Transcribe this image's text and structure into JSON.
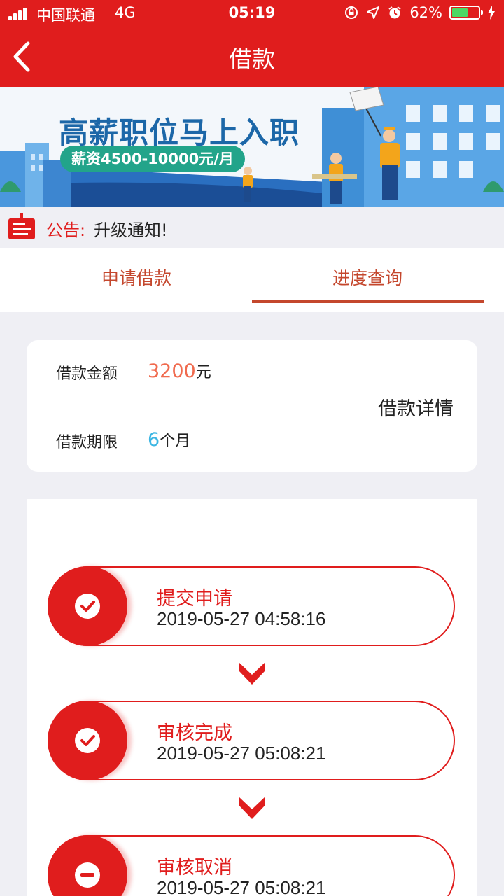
{
  "status_bar": {
    "carrier": "中国联通",
    "network": "4G",
    "time": "05:19",
    "battery_percent": "62%",
    "battery_level": 0.62,
    "icons": [
      "orientation-lock-icon",
      "location-icon",
      "alarm-icon",
      "charging-icon"
    ]
  },
  "nav": {
    "title": "借款",
    "back_icon": "chevron-left-icon"
  },
  "banner": {
    "headline": "高薪职位马上入职",
    "salary": "薪资4500-10000元/月"
  },
  "notice": {
    "tag": "公告:",
    "text": "升级通知!"
  },
  "tabs": [
    {
      "label": "申请借款",
      "active": false
    },
    {
      "label": "进度查询",
      "active": true
    }
  ],
  "loan": {
    "amount_label": "借款金额",
    "amount_value": "3200",
    "amount_unit": "元",
    "term_label": "借款期限",
    "term_value": "6",
    "term_unit": "个月",
    "detail_link": "借款详情"
  },
  "steps": [
    {
      "title": "提交申请",
      "time": "2019-05-27 04:58:16",
      "icon": "check-icon"
    },
    {
      "title": "审核完成",
      "time": "2019-05-27 05:08:21",
      "icon": "check-icon"
    },
    {
      "title": "审核取消",
      "time": "2019-05-27 05:08:21",
      "icon": "minus-icon"
    }
  ],
  "colors": {
    "brand_red": "#e01d1d",
    "tab_text": "#c4472d",
    "amount": "#f06a4e",
    "term": "#3cb6e3",
    "background": "#efeff4"
  }
}
